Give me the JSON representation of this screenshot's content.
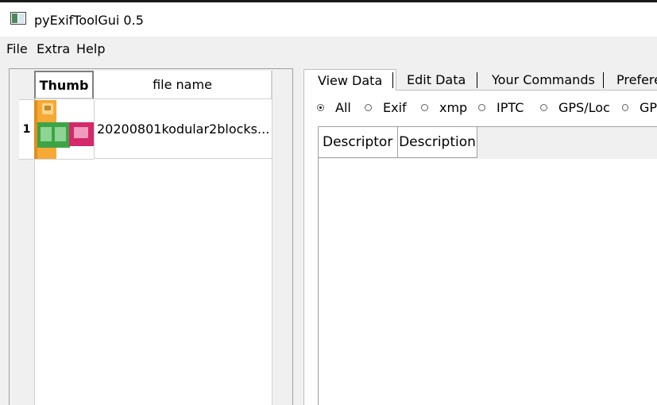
{
  "window": {
    "title": "pyExifToolGui 0.5"
  },
  "menu": {
    "items": [
      "File",
      "Extra",
      "Help"
    ]
  },
  "file_table": {
    "headers": [
      "Thumb",
      "file name"
    ],
    "rows": [
      {
        "row_number": "1",
        "file_name": "20200801kodular2blocks..."
      }
    ]
  },
  "tabs": [
    "View Data",
    "Edit Data",
    "Your Commands",
    "Prefere"
  ],
  "active_tab": "View Data",
  "filters": {
    "options": [
      "All",
      "Exif",
      "xmp",
      "IPTC",
      "GPS/Loc",
      "GP"
    ],
    "selected": "All"
  },
  "data_table": {
    "headers": [
      "Descriptor",
      "Description"
    ]
  },
  "colors": {
    "thumb_orange": "#f7a935",
    "thumb_green": "#3da446",
    "thumb_pink": "#d4286a"
  }
}
